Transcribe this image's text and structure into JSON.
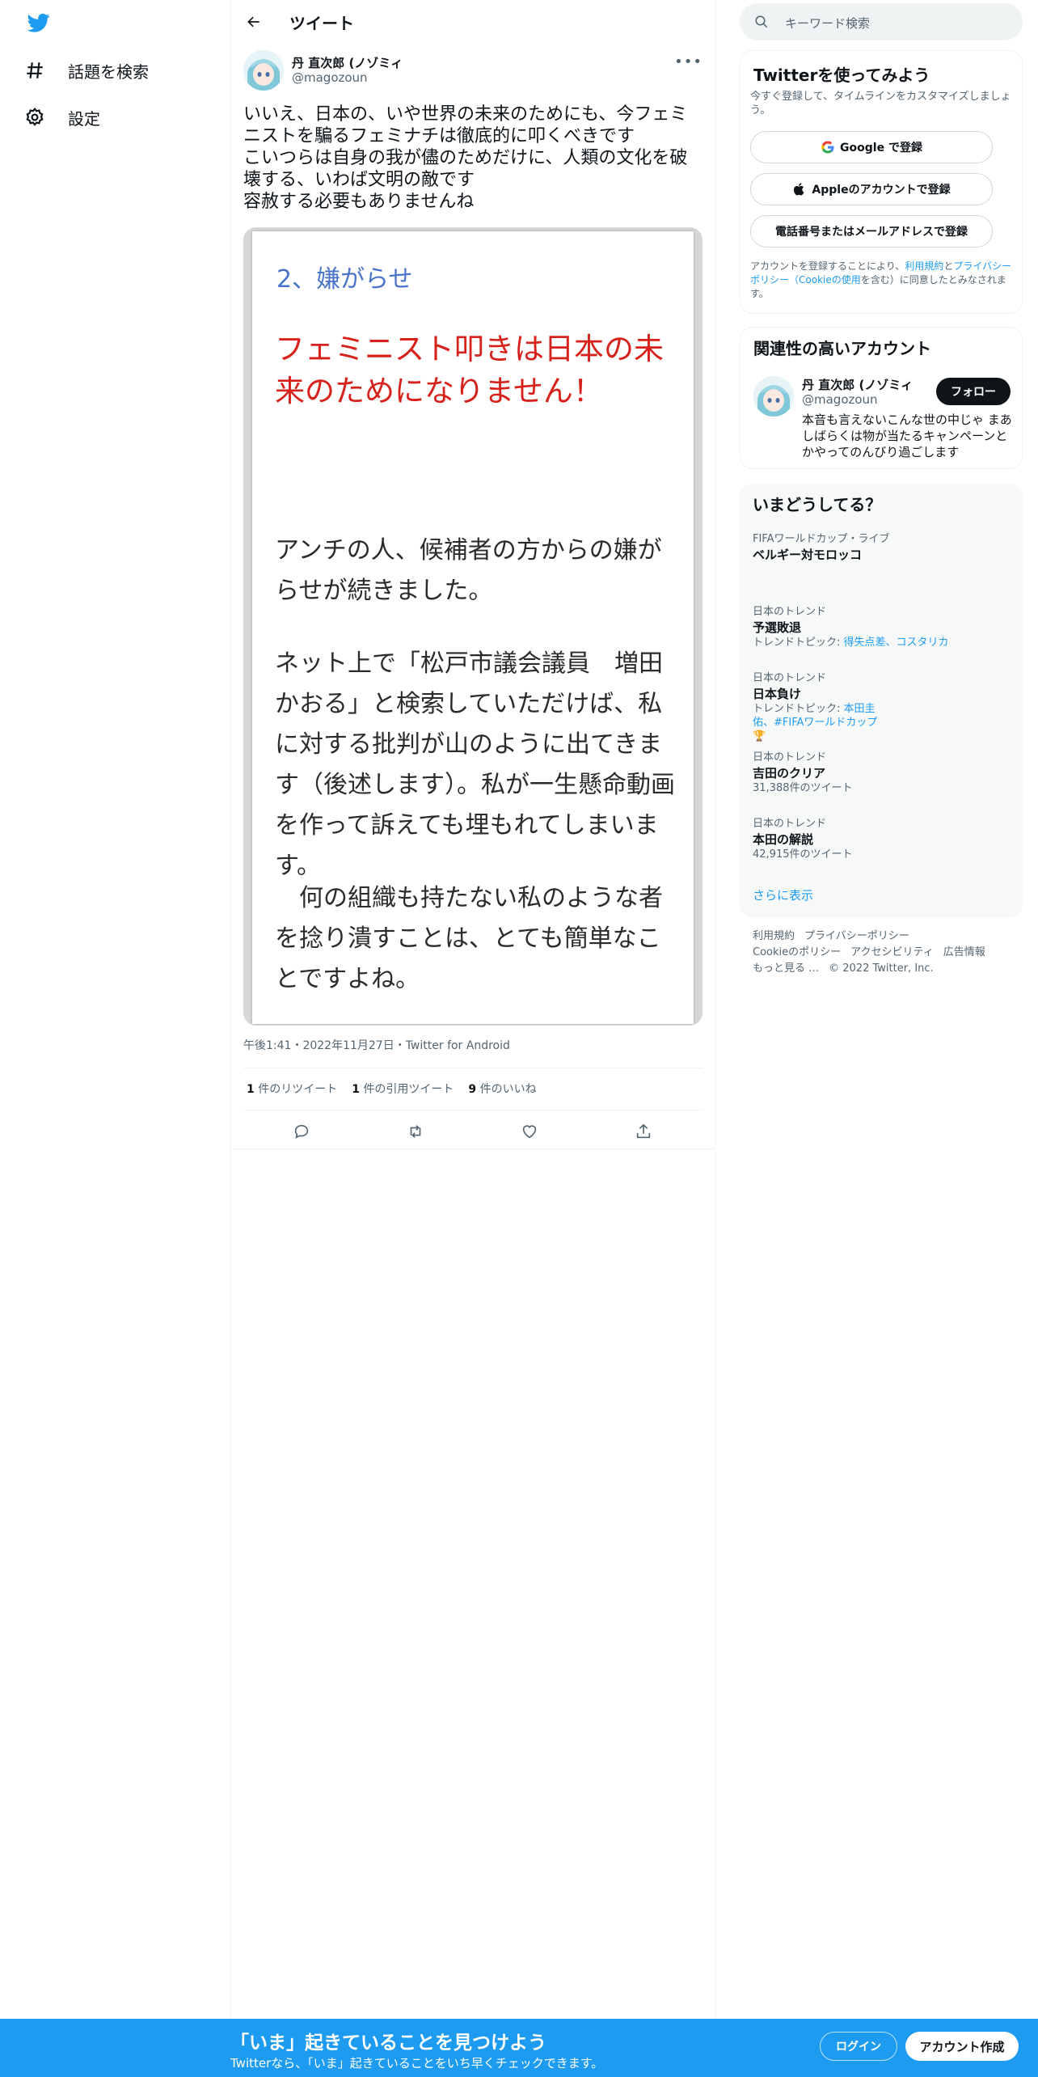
{
  "nav": {
    "items": [
      {
        "label": "話題を検索",
        "icon": "hashtag-icon"
      },
      {
        "label": "設定",
        "icon": "gear-icon"
      }
    ]
  },
  "header": {
    "title": "ツイート"
  },
  "tweet": {
    "author_name": "丹 直次郎 (ノゾミィ",
    "author_handle": "@magozoun",
    "text": "いいえ、日本の、いや世界の未来のためにも、今フェミニストを騙るフェミナチは徹底的に叩くべきです\nこいつらは自身の我が儘のためだけに、人類の文化を破壊する、いわば文明の敵です\n容赦する必要もありませんね",
    "image": {
      "heading": "2、嫌がらせ",
      "red_text": "フェミニスト叩きは日本の未来のためになりません！",
      "para1": "アンチの人、候補者の方からの嫌がらせが続きました。",
      "para2": "ネット上で「松戸市議会議員　増田かおる」と検索していただけば、私に対する批判が山のように出てきます（後述します）。私が一生懸命動画を作って訴えても埋もれてしまいます。",
      "para3": "　何の組織も持たない私のような者を捻り潰すことは、とても簡単なことですよね。"
    },
    "meta": "午後1:41・2022年11月27日・Twitter for Android",
    "stats": {
      "retweets_count": "1",
      "retweets_label": " 件のリツイート",
      "quotes_count": "1",
      "quotes_label": " 件の引用ツイート",
      "likes_count": "9",
      "likes_label": " 件のいいね"
    }
  },
  "sidebar": {
    "search_placeholder": "キーワード検索",
    "signup": {
      "title": "Twitterを使ってみよう",
      "subtitle": "今すぐ登録して、タイムラインをカスタマイズしましょう。",
      "google": "Google で登録",
      "apple": "Appleのアカウントで登録",
      "phone": "電話番号またはメールアドレスで登録",
      "legal_pre": "アカウントを登録することにより、",
      "legal_terms": "利用規約",
      "legal_and": "と",
      "legal_privacy": "プライバシーポリシー（Cookieの使用",
      "legal_post": "を含む）に同意したとみなされます。"
    },
    "related": {
      "title": "関連性の高いアカウント",
      "name": "丹 直次郎 (ノゾミィ",
      "handle": "@magozoun",
      "follow": "フォロー",
      "bio": "本音も言えないこんな世の中じゃ まあしばらくは物が当たるキャンペーンとかやってのんびり過ごします"
    },
    "trends": {
      "title": "いまどうしてる？",
      "items": [
        {
          "ctx": "FIFAワールドカップ・ライブ",
          "title": "ベルギー対モロッコ",
          "extra_label": "",
          "extra_links": ""
        },
        {
          "ctx": "日本のトレンド",
          "title": "予選敗退",
          "extra_label": "トレンドトピック: ",
          "extra_links": "得失点差、コスタリカ"
        },
        {
          "ctx": "日本のトレンド",
          "title": "日本負け",
          "extra_label": "トレンドトピック: ",
          "extra_links": "本田圭佑、#FIFAワールドカップ🏆"
        },
        {
          "ctx": "日本のトレンド",
          "title": "吉田のクリア",
          "extra_label": "31,388件のツイート",
          "extra_links": ""
        },
        {
          "ctx": "日本のトレンド",
          "title": "本田の解説",
          "extra_label": "42,915件のツイート",
          "extra_links": ""
        }
      ],
      "show_more": "さらに表示"
    },
    "footer": {
      "links": [
        "利用規約",
        "プライバシーポリシー",
        "Cookieのポリシー",
        "アクセシビリティ",
        "広告情報",
        "もっと見る …"
      ],
      "copyright": "© 2022 Twitter, Inc."
    }
  },
  "bottombar": {
    "title": "「いま」起きていることを見つけよう",
    "subtitle": "Twitterなら、「いま」起きていることをいち早くチェックできます。",
    "login": "ログイン",
    "signup": "アカウント作成"
  },
  "colors": {
    "accent": "#1d9bf0",
    "red_text": "#d7211b",
    "heading_blue": "#4a74c9"
  }
}
